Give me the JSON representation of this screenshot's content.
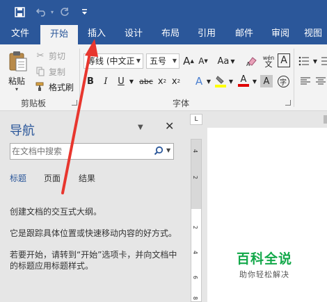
{
  "qat": {
    "save_icon": "save-icon",
    "undo_icon": "undo-icon",
    "redo_icon": "redo-icon",
    "customize_icon": "customize-qat-icon"
  },
  "tabs": [
    "文件",
    "开始",
    "插入",
    "设计",
    "布局",
    "引用",
    "邮件",
    "审阅",
    "视图"
  ],
  "active_tab": "开始",
  "clipboard": {
    "paste": "粘贴",
    "cut": "剪切",
    "copy": "复制",
    "format_painter": "格式刷",
    "group_label": "剪贴板"
  },
  "font": {
    "font_name": "等线 (中文正文)",
    "font_size": "五号",
    "group_label": "字体",
    "grow": "A",
    "shrink": "A",
    "case": "Aa",
    "bold": "B",
    "italic": "I",
    "underline": "U",
    "strike": "abc",
    "subscript": "x",
    "superscript": "x",
    "text_effects": "A",
    "font_color": "A",
    "char_shading": "A",
    "enclose": "字",
    "phonetic": "wén"
  },
  "colors": {
    "brand": "#2b579a",
    "highlight": "#ffff00",
    "font_color": "#e00000",
    "watermark_green": "#13a84a",
    "arrow_red": "#e8362e"
  },
  "nav": {
    "title": "导航",
    "search_placeholder": "在文档中搜索",
    "tabs": [
      "标题",
      "页面",
      "结果"
    ],
    "active_tab": "标题",
    "line1": "创建文档的交互式大纲。",
    "line2": "它是跟踪具体位置或快速移动内容的好方式。",
    "line3a": "若要开始，请转到“开始”选项卡，并向文档中",
    "line3b": "的标题应用标题样式。"
  },
  "ruler": {
    "corner": "L",
    "numbers": [
      "4",
      "2",
      "2",
      "4",
      "6",
      "8"
    ]
  },
  "watermark": {
    "title": "百科全说",
    "subtitle": "助你轻松解决"
  }
}
